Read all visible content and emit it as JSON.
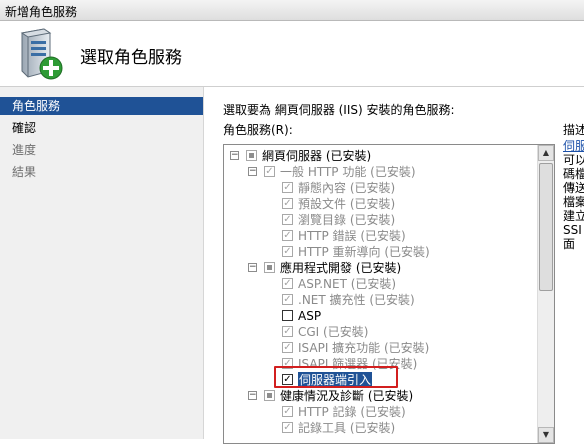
{
  "window": {
    "title": "新增角色服務"
  },
  "header": {
    "title": "選取角色服務"
  },
  "sidebar": {
    "items": [
      {
        "label": "角色服務",
        "state": "active"
      },
      {
        "label": "確認",
        "state": "normal"
      },
      {
        "label": "進度",
        "state": "disabled"
      },
      {
        "label": "結果",
        "state": "disabled"
      }
    ]
  },
  "main": {
    "instruction": "選取要為 網頁伺服器 (IIS) 安裝的角色服務:",
    "list_label": "角色服務(R):",
    "tree": [
      {
        "label": "網頁伺服器 (已安裝)",
        "level": 0,
        "expander": "⊟",
        "check": "partial",
        "dim": false
      },
      {
        "label": "一般 HTTP 功能 (已安裝)",
        "level": 1,
        "expander": "⊟",
        "check": "checked",
        "dim": true
      },
      {
        "label": "靜態內容 (已安裝)",
        "level": 2,
        "check": "checked",
        "dim": true
      },
      {
        "label": "預設文件 (已安裝)",
        "level": 2,
        "check": "checked",
        "dim": true
      },
      {
        "label": "瀏覽目錄 (已安裝)",
        "level": 2,
        "check": "checked",
        "dim": true
      },
      {
        "label": "HTTP 錯誤 (已安裝)",
        "level": 2,
        "check": "checked",
        "dim": true
      },
      {
        "label": "HTTP 重新導向 (已安裝)",
        "level": 2,
        "check": "checked",
        "dim": true
      },
      {
        "label": "應用程式開發 (已安裝)",
        "level": 1,
        "expander": "⊟",
        "check": "partial",
        "dim": false
      },
      {
        "label": "ASP.NET (已安裝)",
        "level": 2,
        "check": "checked",
        "dim": true
      },
      {
        "label": ".NET 擴充性 (已安裝)",
        "level": 2,
        "check": "checked",
        "dim": true
      },
      {
        "label": "ASP",
        "level": 2,
        "check": "unchecked",
        "dim": false
      },
      {
        "label": "CGI (已安裝)",
        "level": 2,
        "check": "checked",
        "dim": true
      },
      {
        "label": "ISAPI 擴充功能 (已安裝)",
        "level": 2,
        "check": "checked",
        "dim": true
      },
      {
        "label": "ISAPI 篩選器 (已安裝)",
        "level": 2,
        "check": "checked",
        "dim": true
      },
      {
        "label": "伺服器端引入",
        "level": 2,
        "check": "checked-enabled",
        "dim": false,
        "selected": true
      },
      {
        "label": "健康情況及診斷 (已安裝)",
        "level": 1,
        "expander": "⊟",
        "check": "partial",
        "dim": false
      },
      {
        "label": "HTTP 記錄 (已安裝)",
        "level": 2,
        "check": "checked",
        "dim": true
      },
      {
        "label": "記錄工具 (已安裝)",
        "level": 2,
        "check": "checked",
        "dim": true
      }
    ]
  },
  "description": {
    "title": "描述",
    "link": "伺服",
    "text_lines": [
      "可以",
      "碼檔",
      "傳送",
      "檔案",
      "建立",
      "SSI",
      "面"
    ]
  },
  "colors": {
    "selection": "#1f5296",
    "highlight_box": "#d21f1f",
    "link": "#1a4fa8"
  }
}
